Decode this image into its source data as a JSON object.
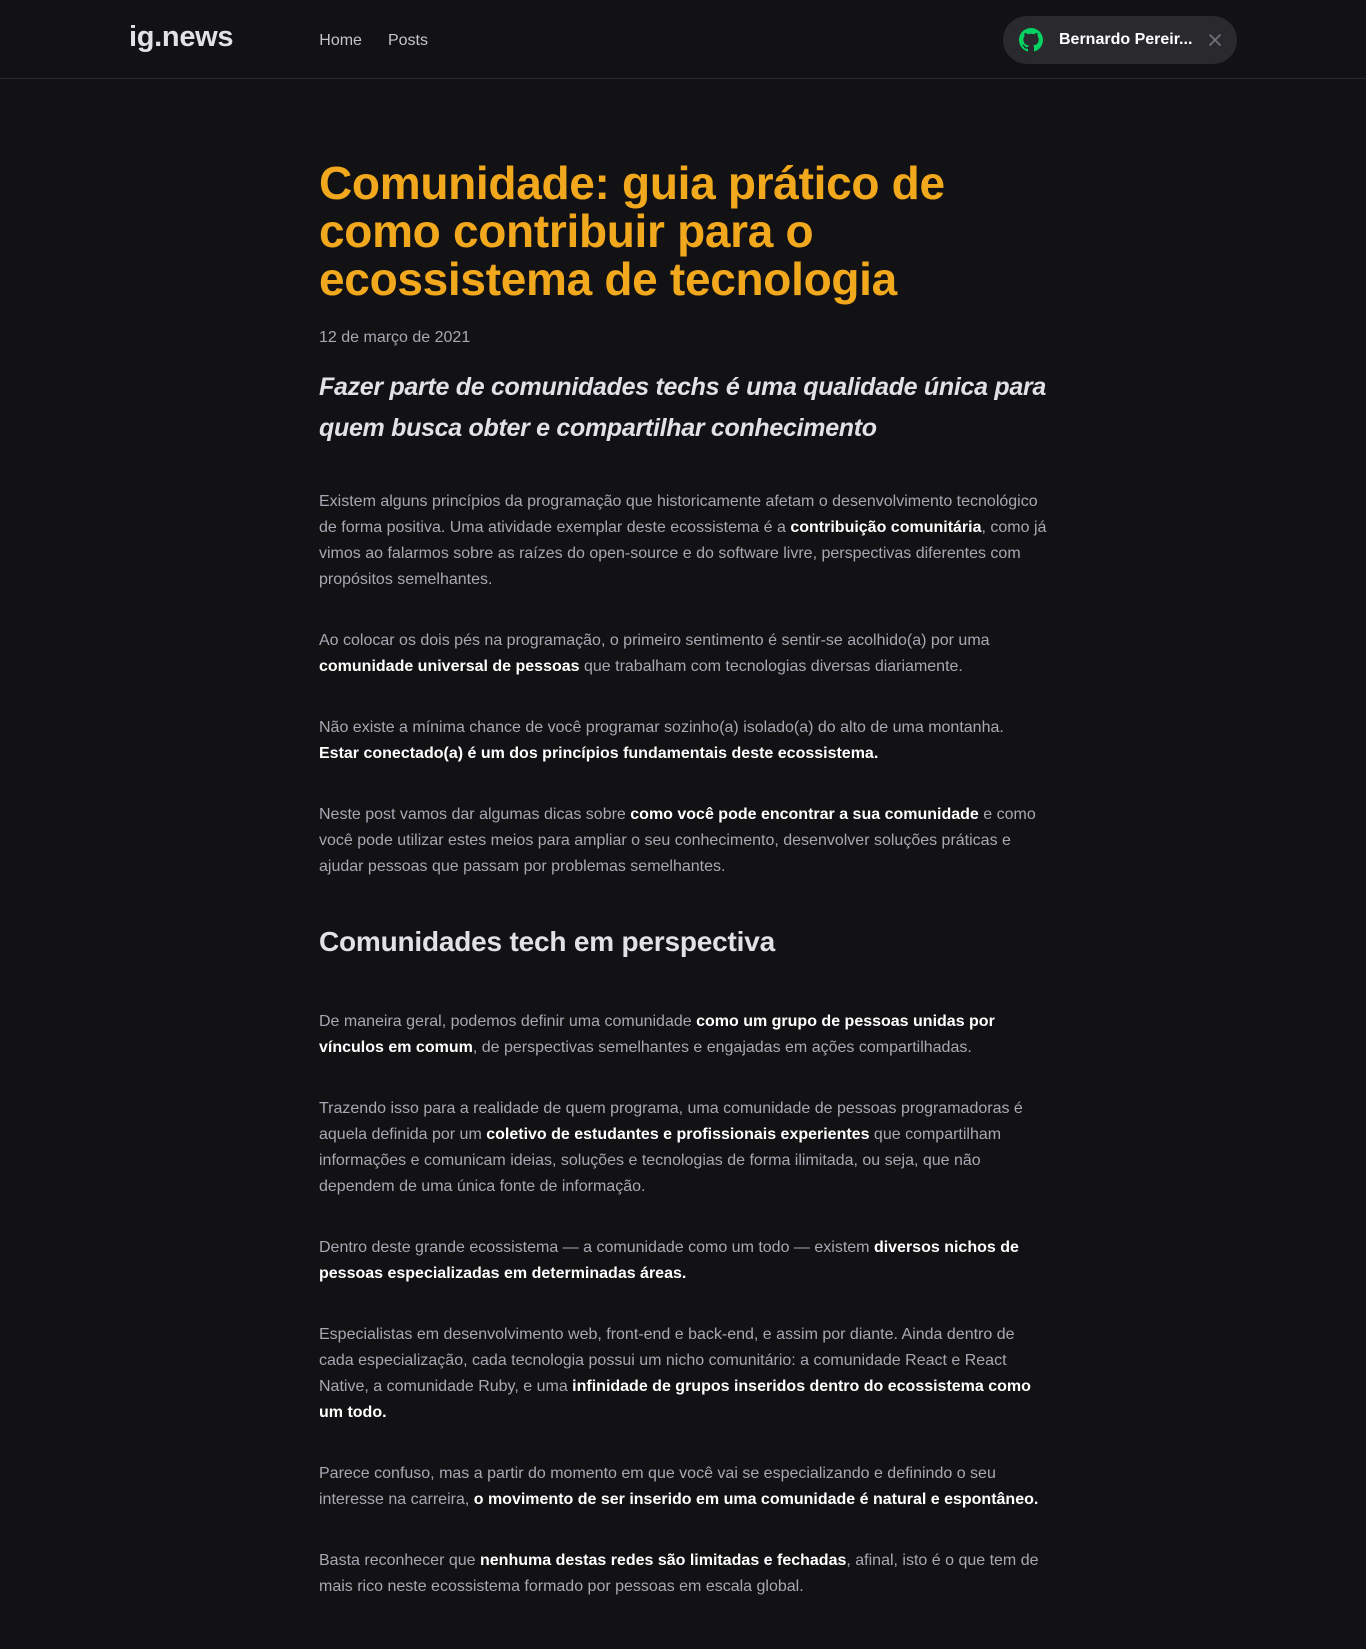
{
  "header": {
    "logo": "ig.news",
    "nav": [
      {
        "label": "Home"
      },
      {
        "label": "Posts"
      }
    ],
    "user": {
      "name": "Bernardo Pereir...",
      "icon": "github-icon",
      "close_icon": "close-icon"
    }
  },
  "colors": {
    "accent": "#f2a81d",
    "github_green": "#04d361",
    "background": "#121214"
  },
  "post": {
    "title": "Comunidade: guia prático de como contribuir para o ecossistema de tecnologia",
    "date": "12 de março de 2021",
    "lead": "Fazer parte de comunidades techs é uma qualidade única para quem busca obter e compartilhar conhecimento",
    "p1": {
      "a": "Existem alguns princípios da programação que historicamente afetam o desenvolvimento tecnológico de forma positiva. Uma atividade exemplar deste ecossistema é a ",
      "b": "contribuição comunitária",
      "c": ", como já vimos ao falarmos sobre as raízes do open-source e do software livre, perspectivas diferentes com propósitos semelhantes."
    },
    "p2": {
      "a": "Ao colocar os dois pés na programação, o primeiro sentimento é sentir-se acolhido(a) por uma ",
      "b": "comunidade universal de pessoas",
      "c": " que trabalham com tecnologias diversas diariamente."
    },
    "p3": {
      "a": "Não existe a mínima chance de você programar sozinho(a) isolado(a) do alto de uma montanha. ",
      "b": "Estar conectado(a) é um dos princípios fundamentais deste ecossistema."
    },
    "p4": {
      "a": "Neste post vamos dar algumas dicas sobre ",
      "b": "como você pode encontrar a sua comunidade",
      "c": " e como você pode utilizar estes meios para ampliar o seu conhecimento, desenvolver soluções práticas e ajudar pessoas que passam por problemas semelhantes."
    },
    "section_title": "Comunidades tech em perspectiva",
    "p5": {
      "a": "De maneira geral, podemos definir uma comunidade ",
      "b": "como um grupo de pessoas unidas por vínculos em comum",
      "c": ", de perspectivas semelhantes e engajadas em ações compartilhadas."
    },
    "p6": {
      "a": "Trazendo isso para a realidade de quem programa, uma comunidade de pessoas programadoras é aquela definida por um ",
      "b": "coletivo de estudantes e profissionais experientes",
      "c": " que compartilham informações e comunicam ideias, soluções e tecnologias de forma ilimitada, ou seja, que não dependem de uma única fonte de informação."
    },
    "p7": {
      "a": "Dentro deste grande ecossistema — a comunidade como um todo — existem ",
      "b": "diversos nichos de pessoas especializadas em determinadas áreas."
    },
    "p8": {
      "a": "Especialistas em desenvolvimento web, front-end e back-end, e assim por diante. Ainda dentro de cada especialização, cada tecnologia possui um nicho comunitário: a comunidade React e React Native, a comunidade Ruby, e uma ",
      "b": "infinidade de grupos inseridos dentro do ecossistema como um todo."
    },
    "p9": {
      "a": "Parece confuso, mas a partir do momento em que você vai se especializando e definindo o seu interesse na carreira, ",
      "b": "o movimento de ser inserido em uma comunidade é natural e espontâneo."
    },
    "p10": {
      "a": "Basta reconhecer que ",
      "b": "nenhuma destas redes são limitadas e fechadas",
      "c": ", afinal, isto é o que tem de mais rico neste ecossistema formado por pessoas em escala global."
    }
  }
}
